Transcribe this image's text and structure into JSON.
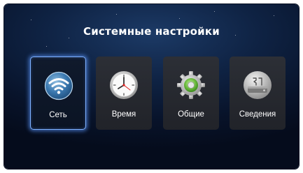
{
  "header": {
    "title": "Системные настройки"
  },
  "menu": {
    "items": [
      {
        "label": "Сеть",
        "icon": "wifi-icon",
        "selected": true
      },
      {
        "label": "Время",
        "icon": "clock-icon",
        "selected": false
      },
      {
        "label": "Общие",
        "icon": "gear-icon",
        "selected": false
      },
      {
        "label": "Сведения",
        "icon": "info-icon",
        "selected": false
      }
    ]
  },
  "colors": {
    "background": "#0f2344",
    "tile": "#2a2d33",
    "selection_glow": "#7fb2ff",
    "text": "#ffffff"
  }
}
